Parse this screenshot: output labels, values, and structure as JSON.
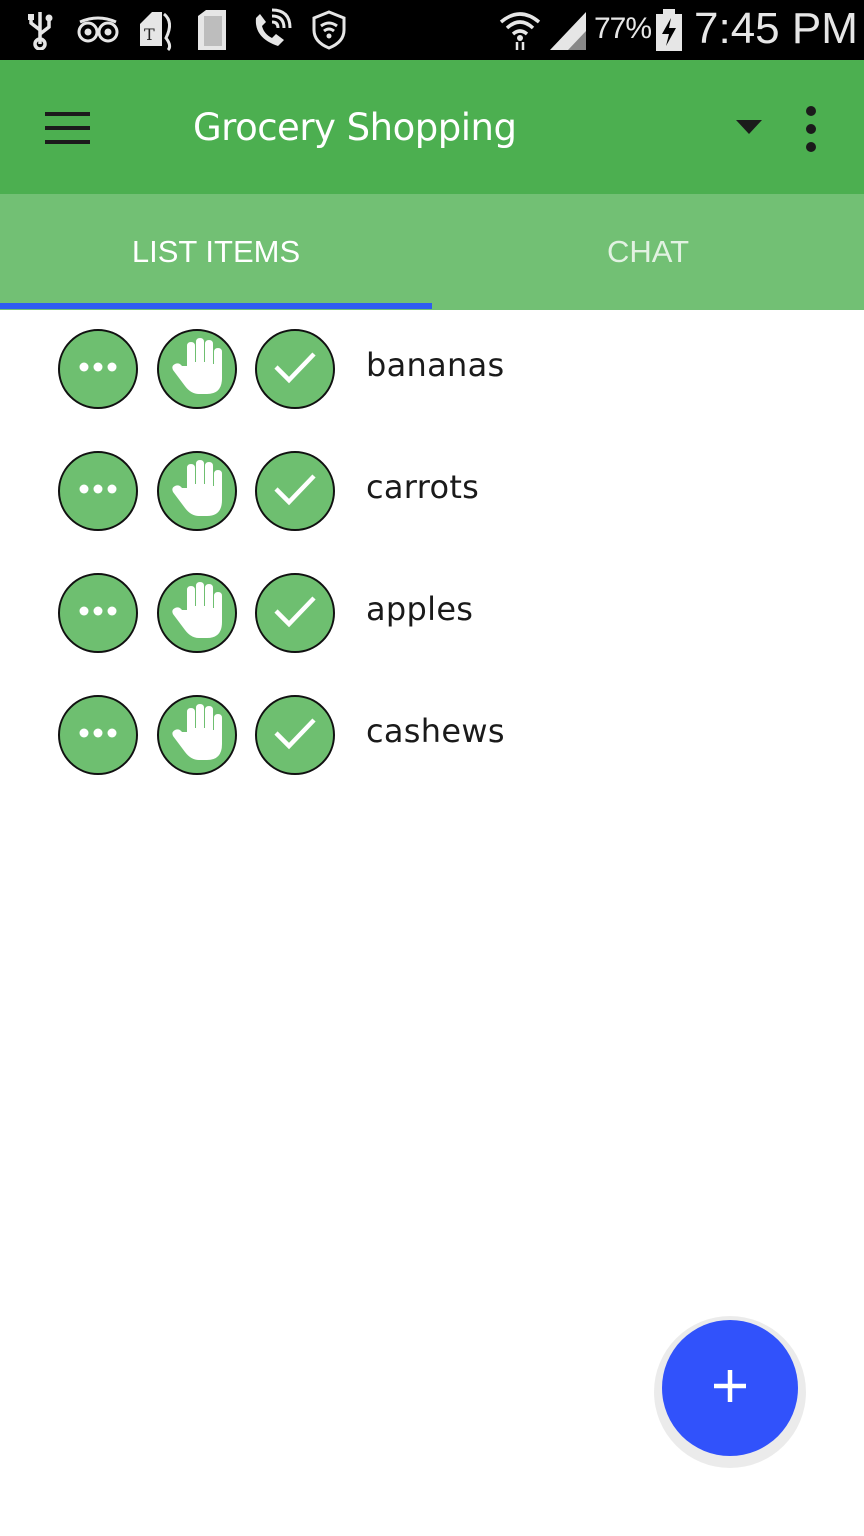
{
  "status_bar": {
    "icons_left": [
      "usb-icon",
      "tripadvisor-icon",
      "tmobile-tag-icon",
      "sd-card-icon",
      "wifi-calling-icon",
      "shield-icon"
    ],
    "icons_right": [
      "wifi-icon",
      "signal-icon",
      "battery-charging-icon"
    ],
    "battery_percent": "77%",
    "time": "7:45 PM"
  },
  "toolbar": {
    "title": "Grocery Shopping",
    "icons": [
      "menu-icon",
      "dropdown-icon",
      "overflow-menu-icon"
    ]
  },
  "tabs": [
    {
      "label": "LIST ITEMS",
      "selected": true
    },
    {
      "label": "CHAT",
      "selected": false
    }
  ],
  "list": {
    "row_icons": [
      "more-icon",
      "raise-hand-icon",
      "check-icon"
    ],
    "items": [
      {
        "label": "bananas"
      },
      {
        "label": "carrots"
      },
      {
        "label": "apples"
      },
      {
        "label": "cashews"
      }
    ]
  },
  "fab": {
    "icon": "plus-icon"
  },
  "colors": {
    "toolbar": "#4caf50",
    "tabbar": "#72c074",
    "tab_indicator": "#2f5cf2",
    "row_button": "#6ebf70",
    "fab": "#3152fb"
  }
}
